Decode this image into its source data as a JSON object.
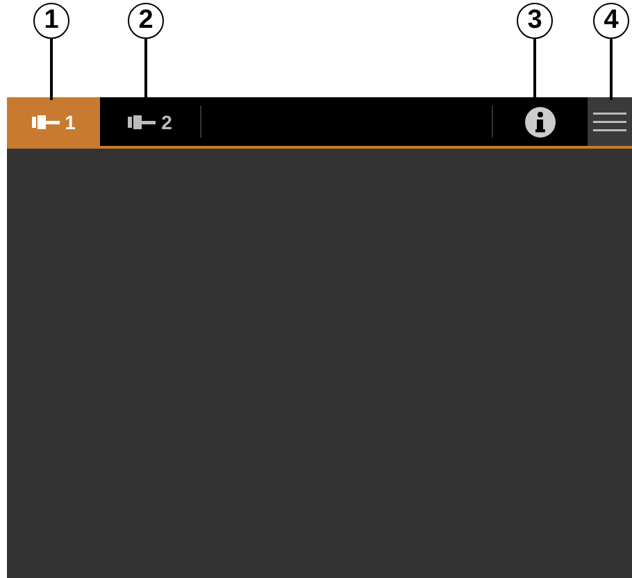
{
  "callouts": [
    {
      "number": "1"
    },
    {
      "number": "2"
    },
    {
      "number": "3"
    },
    {
      "number": "4"
    }
  ],
  "tabs": [
    {
      "label": "1",
      "selected": true
    },
    {
      "label": "2",
      "selected": false
    }
  ]
}
